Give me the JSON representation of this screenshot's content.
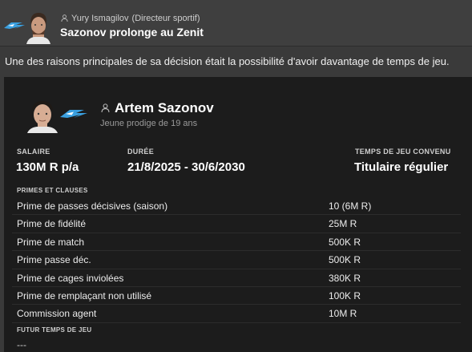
{
  "header": {
    "sender_name": "Yury Ismagilov",
    "sender_role": "(Directeur sportif)",
    "headline": "Sazonov prolonge au Zenit"
  },
  "intro_text": "Une des raisons principales de sa décision était la possibilité d'avoir davantage de temps de jeu.",
  "player": {
    "name": "Artem Sazonov",
    "subtitle": "Jeune prodige de 19 ans"
  },
  "contract": {
    "salary_label": "SALAIRE",
    "salary_value": "130M R p/a",
    "duration_label": "DURÉE",
    "duration_value": "21/8/2025 - 30/6/2030",
    "playtime_label": "TEMPS DE JEU CONVENU",
    "playtime_value": "Titulaire régulier"
  },
  "bonuses": {
    "title": "PRIMES ET CLAUSES",
    "rows": [
      {
        "label": "Prime de passes décisives (saison)",
        "value": "10 (6M R)"
      },
      {
        "label": "Prime de fidélité",
        "value": "25M R"
      },
      {
        "label": "Prime de match",
        "value": "500K R"
      },
      {
        "label": "Prime passe déc.",
        "value": "500K R"
      },
      {
        "label": "Prime de cages inviolées",
        "value": "380K R"
      },
      {
        "label": "Prime de remplaçant non utilisé",
        "value": "100K R"
      },
      {
        "label": "Commission agent",
        "value": "10M R"
      }
    ]
  },
  "future": {
    "title": "FUTUR TEMPS DE JEU",
    "value": "---"
  },
  "icons": {
    "club": "zenit-logo",
    "person": "person-icon"
  },
  "colors": {
    "background": "#3a3a3a",
    "panel": "#1c1c1c",
    "club_blue": "#3aa0e0"
  }
}
